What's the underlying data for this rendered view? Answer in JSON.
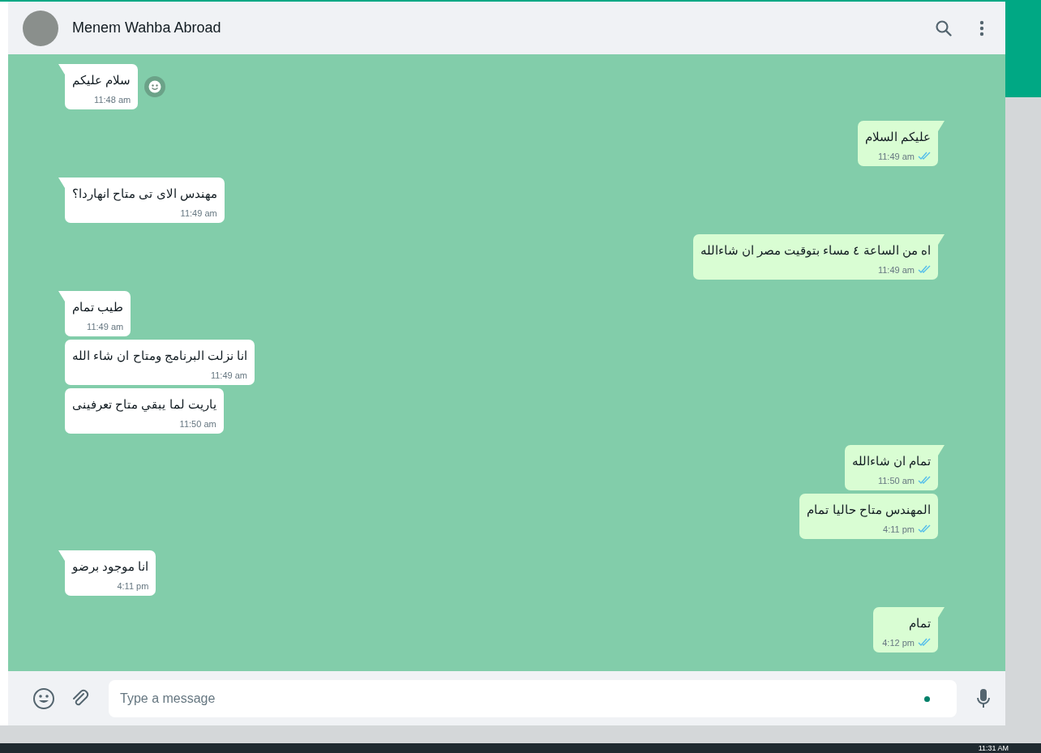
{
  "header": {
    "contact_name": "Menem Wahba Abroad"
  },
  "messages": [
    {
      "kind": "in",
      "text": "سلام عليكم",
      "time": "11:48 am",
      "tail": true,
      "reaction_button": true
    },
    {
      "kind": "out",
      "text": "عليكم السلام",
      "time": "11:49 am",
      "tail": true,
      "reaction_button": false,
      "read": true
    },
    {
      "kind": "in",
      "text": "مهندس الاى تى متاح انهاردا؟",
      "time": "11:49 am",
      "tail": true,
      "reaction_button": false
    },
    {
      "kind": "out",
      "text": "اه من الساعة ٤ مساء بتوقيت مصر ان شاءالله",
      "time": "11:49 am",
      "tail": true,
      "reaction_button": false,
      "read": true
    },
    {
      "kind": "in",
      "text": "طيب تمام",
      "time": "11:49 am",
      "tail": true,
      "reaction_button": false
    },
    {
      "kind": "in",
      "text": "انا نزلت البرنامج ومتاح ان شاء الله",
      "time": "11:49 am",
      "tail": false,
      "reaction_button": false
    },
    {
      "kind": "in",
      "text": "ياريت لما يبقي متاح تعرفينى",
      "time": "11:50 am",
      "tail": false,
      "reaction_button": false
    },
    {
      "kind": "out",
      "text": "تمام ان شاءالله",
      "time": "11:50 am",
      "tail": true,
      "reaction_button": false,
      "read": true
    },
    {
      "kind": "out",
      "text": "المهندس متاح حاليا تمام",
      "time": "4:11 pm",
      "tail": false,
      "reaction_button": false,
      "read": true
    },
    {
      "kind": "in",
      "text": "انا موجود برضو",
      "time": "4:11 pm",
      "tail": true,
      "reaction_button": false
    },
    {
      "kind": "out",
      "text": "تمام",
      "time": "4:12 pm",
      "tail": true,
      "reaction_button": false,
      "read": true
    }
  ],
  "composer": {
    "placeholder": "Type a message"
  },
  "taskbar": {
    "clock": "11:31 AM"
  }
}
